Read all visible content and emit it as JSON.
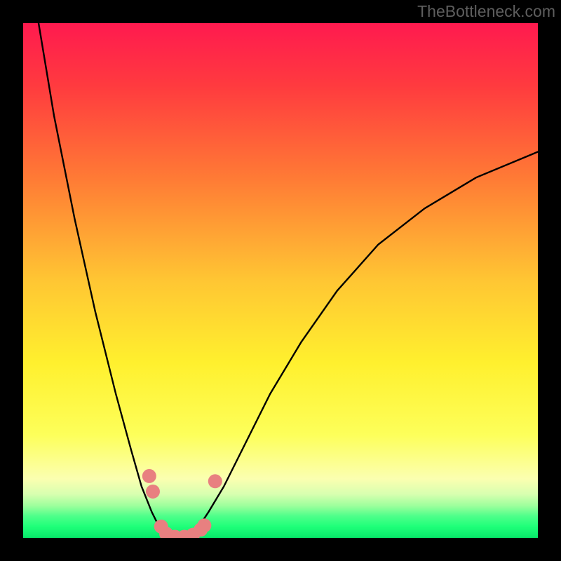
{
  "watermark": "TheBottleneck.com",
  "chart_data": {
    "type": "line",
    "title": "",
    "xlabel": "",
    "ylabel": "",
    "xlim": [
      0,
      100
    ],
    "ylim": [
      0,
      100
    ],
    "background_gradient": {
      "stops": [
        {
          "pos": 0.0,
          "color": "#ff1a4f"
        },
        {
          "pos": 0.12,
          "color": "#ff3a3f"
        },
        {
          "pos": 0.3,
          "color": "#ff7a35"
        },
        {
          "pos": 0.5,
          "color": "#ffc633"
        },
        {
          "pos": 0.66,
          "color": "#fff02e"
        },
        {
          "pos": 0.8,
          "color": "#fdff5a"
        },
        {
          "pos": 0.885,
          "color": "#fbffb0"
        },
        {
          "pos": 0.915,
          "color": "#d8ffb0"
        },
        {
          "pos": 0.938,
          "color": "#9cff9c"
        },
        {
          "pos": 0.958,
          "color": "#4dff8a"
        },
        {
          "pos": 0.978,
          "color": "#1fff79"
        },
        {
          "pos": 1.0,
          "color": "#07e86a"
        }
      ]
    },
    "curve": {
      "description": "V-shaped bottleneck curve; minimum near x≈30, rises steeply toward both edges",
      "x": [
        3,
        6,
        10,
        14,
        18,
        21,
        23,
        25,
        26.5,
        28,
        30,
        32,
        34,
        36,
        39,
        43,
        48,
        54,
        61,
        69,
        78,
        88,
        100
      ],
      "y": [
        100,
        82,
        62,
        44,
        28,
        17,
        10,
        5,
        2,
        0.5,
        0,
        0.5,
        2,
        5,
        10,
        18,
        28,
        38,
        48,
        57,
        64,
        70,
        75
      ]
    },
    "markers": {
      "color": "#e88080",
      "radius_px": 10,
      "points": [
        {
          "x": 24.5,
          "y": 12
        },
        {
          "x": 25.2,
          "y": 9
        },
        {
          "x": 26.8,
          "y": 2.2
        },
        {
          "x": 27.8,
          "y": 0.8
        },
        {
          "x": 29.5,
          "y": 0.2
        },
        {
          "x": 31.3,
          "y": 0.2
        },
        {
          "x": 33.0,
          "y": 0.6
        },
        {
          "x": 34.5,
          "y": 1.6
        },
        {
          "x": 35.2,
          "y": 2.4
        },
        {
          "x": 37.3,
          "y": 11
        }
      ]
    }
  }
}
